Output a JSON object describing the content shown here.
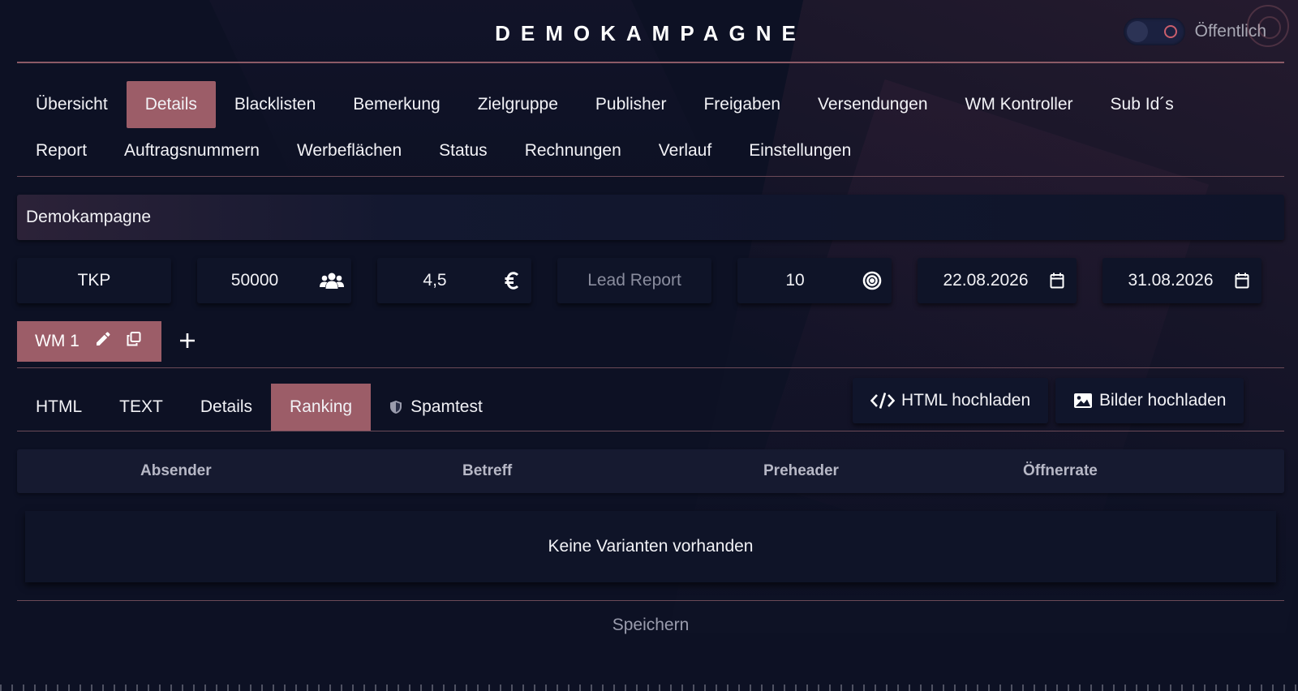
{
  "header": {
    "title": "DEMOKAMPAGNE",
    "public_label": "Öffentlich"
  },
  "nav": {
    "row1": [
      "Übersicht",
      "Details",
      "Blacklisten",
      "Bemerkung",
      "Zielgruppe",
      "Publisher",
      "Freigaben",
      "Versendungen",
      "WM Kontroller",
      "Sub Id´s"
    ],
    "row2": [
      "Report",
      "Auftragsnummern",
      "Werbeflächen",
      "Status",
      "Rechnungen",
      "Verlauf",
      "Einstellungen"
    ],
    "active": "Details"
  },
  "campaign_name": "Demokampagne",
  "fields": {
    "billing_type": "TKP",
    "volume": "50000",
    "volume_icon": "users-icon",
    "price": "4,5",
    "price_icon": "euro-icon",
    "lead_report_placeholder": "Lead Report",
    "target": "10",
    "target_icon": "target-icon",
    "start_date": "22.08.2026",
    "end_date": "31.08.2026",
    "date_icon": "calendar-icon"
  },
  "variants": {
    "tabs": [
      "WM 1"
    ]
  },
  "subtabs": {
    "items": [
      "HTML",
      "TEXT",
      "Details",
      "Ranking",
      "Spamtest"
    ],
    "active": "Ranking",
    "upload_html": "HTML hochladen",
    "upload_images": "Bilder hochladen"
  },
  "table": {
    "columns": [
      "Absender",
      "Betreff",
      "Preheader",
      "Öffnerrate"
    ],
    "empty_message": "Keine Varianten vorhanden"
  },
  "save_label": "Speichern",
  "colors": {
    "accent": "#9c5d68",
    "background": "#0d1124"
  }
}
